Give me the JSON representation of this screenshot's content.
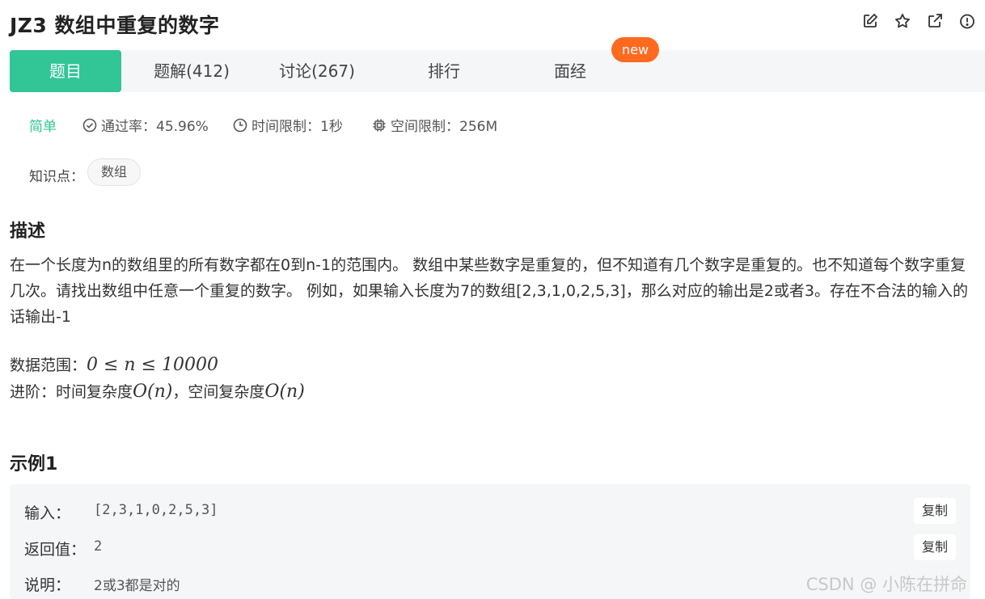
{
  "header": {
    "title": "JZ3  数组中重复的数字",
    "icons": [
      "edit-icon",
      "star-icon",
      "external-link-icon",
      "alert-icon"
    ]
  },
  "tabs": [
    {
      "label": "题目",
      "active": true
    },
    {
      "label": "题解(412)",
      "active": false
    },
    {
      "label": "讨论(267)",
      "active": false
    },
    {
      "label": "排行",
      "active": false
    },
    {
      "label": "面经",
      "active": false
    }
  ],
  "new_badge": "new",
  "meta": {
    "difficulty": "简单",
    "pass_rate": "通过率：45.96%",
    "time_limit": "时间限制：1秒",
    "space_limit": "空间限制：256M"
  },
  "knowledge": {
    "label": "知识点：",
    "tags": [
      "数组"
    ]
  },
  "description": {
    "heading": "描述",
    "text": "在一个长度为n的数组里的所有数字都在0到n-1的范围内。 数组中某些数字是重复的，但不知道有几个数字是重复的。也不知道每个数字重复几次。请找出数组中任意一个重复的数字。 例如，如果输入长度为7的数组[2,3,1,0,2,5,3]，那么对应的输出是2或者3。存在不合法的输入的话输出-1",
    "range_label": "数据范围：",
    "range_math": "0 ≤ n ≤ 10000",
    "advanced_label": "进阶：时间复杂度",
    "advanced_time": "O(n)",
    "advanced_sep": "，空间复杂度",
    "advanced_space": "O(n)"
  },
  "example": {
    "heading": "示例1",
    "input_label": "输入：",
    "input_value": "[2,3,1,0,2,5,3]",
    "return_label": "返回值：",
    "return_value": "2",
    "explain_label": "说明：",
    "explain_value": "2或3都是对的",
    "copy_label": "复制"
  },
  "watermark": "CSDN @  小陈在拼命",
  "colors": {
    "accent": "#32c596",
    "badge": "#ff6a20",
    "tabbar_bg": "#f5f6f8"
  }
}
